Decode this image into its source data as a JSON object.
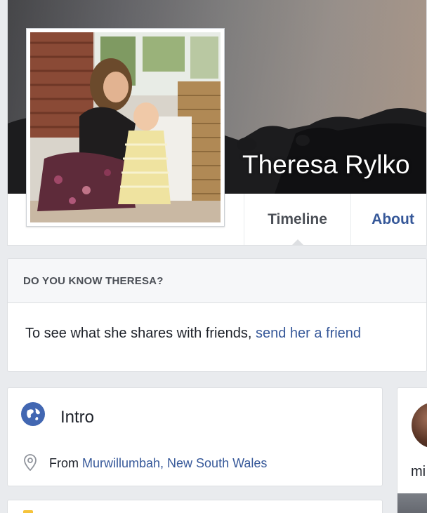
{
  "profile": {
    "name": "Theresa Rylko"
  },
  "tabs": [
    {
      "label": "Timeline"
    },
    {
      "label": "About"
    }
  ],
  "know_card": {
    "heading": "DO YOU KNOW THERESA?",
    "text": "To see what she shares with friends, ",
    "link": "send her a friend"
  },
  "intro": {
    "title": "Intro",
    "from_prefix": "From ",
    "from_location": "Murwillumbah, New South Wales"
  },
  "right_column": {
    "text": "mi"
  },
  "colors": {
    "link": "#365899",
    "background": "#e9ebee",
    "intro_icon": "#4267b2"
  },
  "icons": {
    "intro": "globe-icon",
    "location": "location-pin-icon"
  }
}
